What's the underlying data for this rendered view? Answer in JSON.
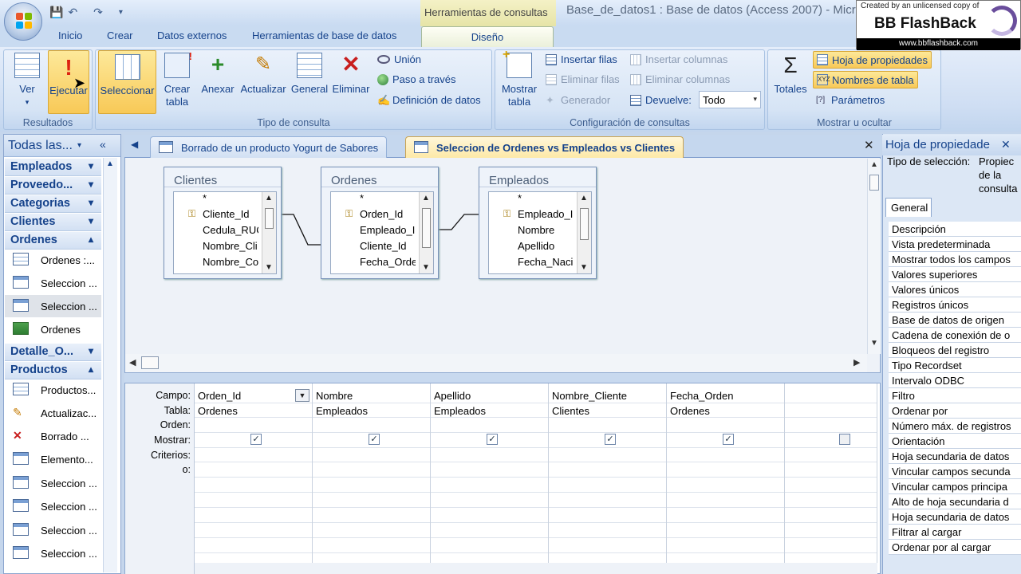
{
  "window": {
    "title": "Base_de_datos1 : Base de datos (Access 2007) - Micro",
    "context_tab_group": "Herramientas de consultas"
  },
  "watermark": {
    "line1": "Created by an unlicensed copy of",
    "brand": "BB FlashBack",
    "url": "www.bbflashback.com"
  },
  "ribbon_tabs": [
    "Inicio",
    "Crear",
    "Datos externos",
    "Herramientas de base de datos",
    "Diseño"
  ],
  "ribbon": {
    "resultados": {
      "label": "Resultados",
      "ver": "Ver",
      "ejecutar": "Ejecutar"
    },
    "tipo": {
      "label": "Tipo de consulta",
      "seleccionar": "Seleccionar",
      "crear_tabla_1": "Crear",
      "crear_tabla_2": "tabla",
      "anexar": "Anexar",
      "actualizar": "Actualizar",
      "general": "General",
      "eliminar": "Eliminar",
      "union": "Unión",
      "paso": "Paso a través",
      "definicion": "Definición de datos"
    },
    "config": {
      "label": "Configuración de consultas",
      "mostrar_tabla_1": "Mostrar",
      "mostrar_tabla_2": "tabla",
      "insertar_filas": "Insertar filas",
      "eliminar_filas": "Eliminar filas",
      "generador": "Generador",
      "insertar_columnas": "Insertar columnas",
      "eliminar_columnas": "Eliminar columnas",
      "devuelve": "Devuelve:",
      "devuelve_value": "Todo"
    },
    "mostrar": {
      "label": "Mostrar u ocultar",
      "totales": "Totales",
      "hoja_prop": "Hoja de propiedades",
      "nombres_tabla": "Nombres de tabla",
      "parametros": "Parámetros"
    }
  },
  "nav": {
    "title": "Todas las...",
    "groups": {
      "empleados": "Empleados",
      "proveedores": "Proveedo...",
      "categorias": "Categorias",
      "clientes": "Clientes",
      "ordenes": "Ordenes",
      "detalle": "Detalle_O...",
      "productos": "Productos"
    },
    "ordenes_items": [
      "Ordenes :...",
      "Seleccion ...",
      "Seleccion ...",
      "Ordenes"
    ],
    "productos_items": [
      "Productos...",
      "Actualizac...",
      "Borrado ...",
      "Elemento...",
      "Seleccion ...",
      "Seleccion ...",
      "Seleccion ...",
      "Seleccion ..."
    ]
  },
  "object_tabs": [
    "Borrado de un producto Yogurt de Sabores",
    "Seleccion de Ordenes vs Empleados vs Clientes"
  ],
  "tables": [
    {
      "name": "Clientes",
      "fields": [
        "*",
        "Cliente_Id",
        "Cedula_RUC",
        "Nombre_Cli",
        "Nombre_Co"
      ]
    },
    {
      "name": "Ordenes",
      "fields": [
        "*",
        "Orden_Id",
        "Empleado_I",
        "Cliente_Id",
        "Fecha_Orde"
      ]
    },
    {
      "name": "Empleados",
      "fields": [
        "*",
        "Empleado_I",
        "Nombre",
        "Apellido",
        "Fecha_Nacin"
      ]
    }
  ],
  "qbe": {
    "row_labels": [
      "Campo:",
      "Tabla:",
      "Orden:",
      "Mostrar:",
      "Criterios:",
      "o:"
    ],
    "columns": [
      {
        "campo": "Orden_Id",
        "tabla": "Ordenes",
        "mostrar": true
      },
      {
        "campo": "Nombre",
        "tabla": "Empleados",
        "mostrar": true
      },
      {
        "campo": "Apellido",
        "tabla": "Empleados",
        "mostrar": true
      },
      {
        "campo": "Nombre_Cliente",
        "tabla": "Clientes",
        "mostrar": true
      },
      {
        "campo": "Fecha_Orden",
        "tabla": "Ordenes",
        "mostrar": true
      },
      {
        "campo": "",
        "tabla": "",
        "mostrar": false
      }
    ]
  },
  "props": {
    "title": "Hoja de propiedade",
    "tipo_label": "Tipo de selección:",
    "tipo_value_1": "Propiec",
    "tipo_value_2": "de la",
    "tipo_value_3": "consulta",
    "tab": "General",
    "rows": [
      "Descripción",
      "Vista predeterminada",
      "Mostrar todos los campos",
      "Valores superiores",
      "Valores únicos",
      "Registros únicos",
      "Base de datos de origen",
      "Cadena de conexión de o",
      "Bloqueos del registro",
      "Tipo Recordset",
      "Intervalo ODBC",
      "Filtro",
      "Ordenar por",
      "Número máx. de registros",
      "Orientación",
      "Hoja secundaria de datos",
      "Vincular campos secunda",
      "Vincular campos principa",
      "Alto de hoja secundaria d",
      "Hoja secundaria de datos",
      "Filtrar al cargar",
      "Ordenar por al cargar"
    ]
  }
}
